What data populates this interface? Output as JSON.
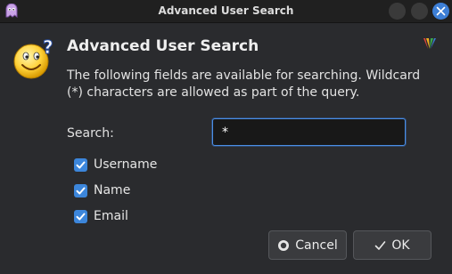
{
  "window": {
    "title": "Advanced User Search",
    "buttons": [
      "minimize",
      "maximize",
      "close"
    ],
    "accent_color": "#3c86db"
  },
  "header": {
    "icon": "smiley-question-icon",
    "title": "Advanced User Search",
    "description": "The following fields are available for searching. Wildcard (*) characters are allowed as part of the query.",
    "brand_icon": "kde-logo-icon"
  },
  "search": {
    "label": "Search:",
    "value": "*"
  },
  "fields": [
    {
      "label": "Username",
      "checked": true
    },
    {
      "label": "Name",
      "checked": true
    },
    {
      "label": "Email",
      "checked": true
    }
  ],
  "buttons": {
    "cancel_label": "Cancel",
    "cancel_icon": "cancel-icon",
    "ok_label": "OK",
    "ok_icon": "checkmark-icon"
  }
}
